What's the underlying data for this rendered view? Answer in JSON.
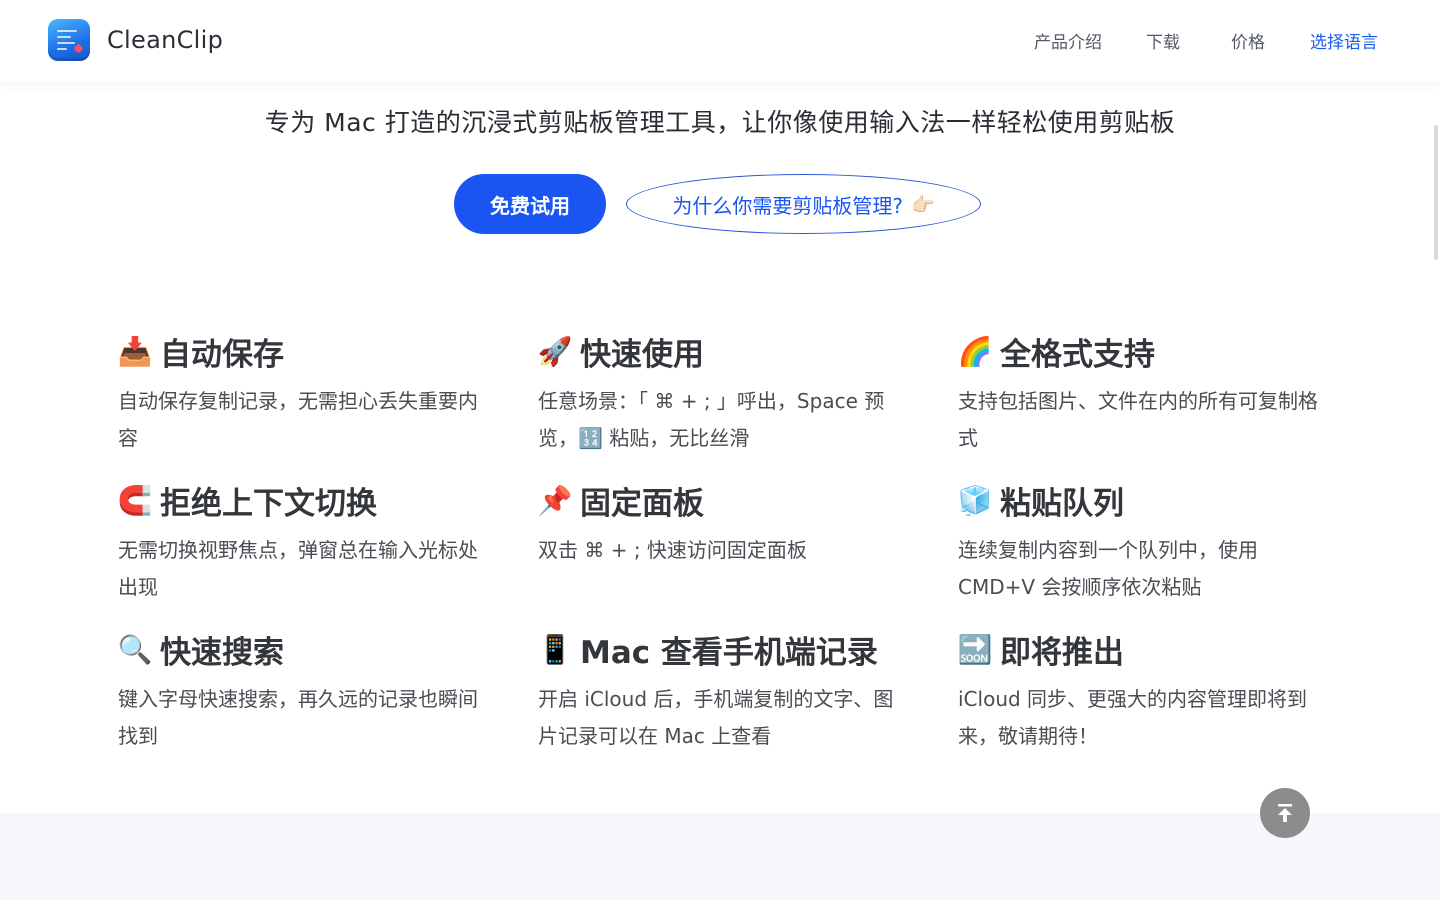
{
  "header": {
    "brand_name": "CleanClip",
    "nav": [
      {
        "label": "产品介绍"
      },
      {
        "label": "下载"
      },
      {
        "label": "价格"
      },
      {
        "label": "选择语言"
      }
    ]
  },
  "hero": {
    "tagline": "专为 Mac 打造的沉浸式剪贴板管理工具，让你像使用输入法一样轻松使用剪贴板",
    "primary_button": "免费试用",
    "secondary_button": "为什么你需要剪贴板管理?",
    "secondary_emoji": "👉🏻"
  },
  "features": [
    {
      "icon": "📥",
      "icon_name": "inbox-tray-icon",
      "title": "自动保存",
      "desc": "自动保存复制记录，无需担心丢失重要内容"
    },
    {
      "icon": "🚀",
      "icon_name": "rocket-icon",
      "title": "快速使用",
      "desc": "任意场景：「 ⌘ + ; 」呼出，Space 预览，🔢 粘贴，无比丝滑"
    },
    {
      "icon": "🌈",
      "icon_name": "rainbow-icon",
      "title": "全格式支持",
      "desc": "支持包括图片、文件在内的所有可复制格式"
    },
    {
      "icon": "🧲",
      "icon_name": "magnet-icon",
      "title": "拒绝上下文切换",
      "desc": "无需切换视野焦点，弹窗总在输入光标处出现"
    },
    {
      "icon": "📌",
      "icon_name": "pushpin-icon",
      "title": "固定面板",
      "desc": "双击 ⌘ + ; 快速访问固定面板"
    },
    {
      "icon": "🧊",
      "icon_name": "ice-cube-icon",
      "title": "粘贴队列",
      "desc": "连续复制内容到一个队列中，使用 CMD+V 会按顺序依次粘贴"
    },
    {
      "icon": "🔍",
      "icon_name": "magnifier-icon",
      "title": "快速搜索",
      "desc": "键入字母快速搜索，再久远的记录也瞬间找到"
    },
    {
      "icon": "📱",
      "icon_name": "mobile-phone-icon",
      "title": "Mac 查看手机端记录",
      "desc": "开启 iCloud 后，手机端复制的文字、图片记录可以在 Mac 上查看"
    },
    {
      "icon": "🔜",
      "icon_name": "soon-arrow-icon",
      "title": "即将推出",
      "desc": "iCloud 同步、更强大的内容管理即将到来，敬请期待！"
    }
  ],
  "colors": {
    "accent": "#1a55f2",
    "nav_active": "#1a5cf0",
    "bottom_band": "#f5f7fd",
    "to_top_button": "#8c8c8c"
  }
}
